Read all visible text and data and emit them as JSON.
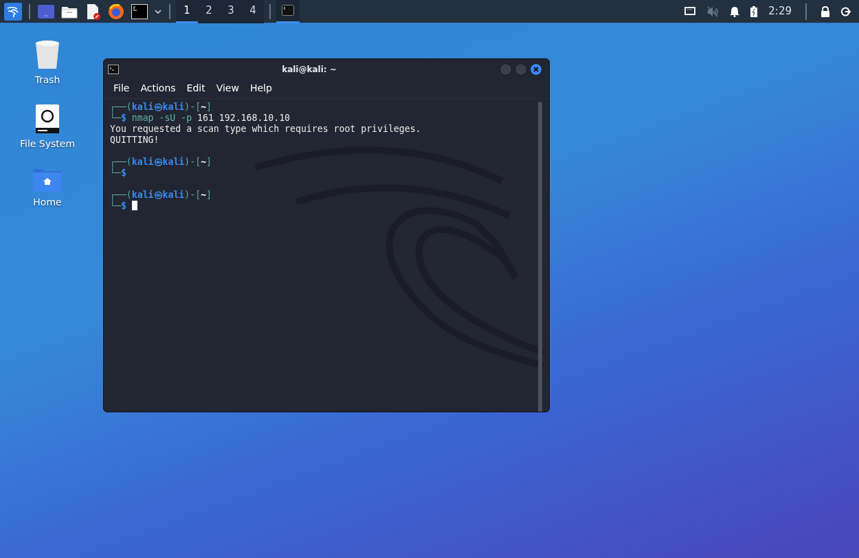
{
  "taskbar": {
    "workspaces": [
      {
        "label": "1",
        "selected": true
      },
      {
        "label": "2",
        "selected": false
      },
      {
        "label": "3",
        "selected": false
      },
      {
        "label": "4",
        "selected": false
      }
    ],
    "tasks": [
      {
        "selected": true
      }
    ],
    "clock": "2:29"
  },
  "desktop_icons": [
    {
      "label": "Trash",
      "kind": "trash"
    },
    {
      "label": "File System",
      "kind": "drive"
    },
    {
      "label": "Home",
      "kind": "home"
    }
  ],
  "window": {
    "title": "kali@kali: ~",
    "menu": [
      "File",
      "Actions",
      "Edit",
      "View",
      "Help"
    ],
    "lines": [
      {
        "segments": [
          {
            "kind": "frame",
            "text": "┌──("
          },
          {
            "kind": "user",
            "text": "kali㉿kali"
          },
          {
            "kind": "frame",
            "text": ")-["
          },
          {
            "kind": "path",
            "text": "~"
          },
          {
            "kind": "frame",
            "text": "]"
          }
        ]
      },
      {
        "segments": [
          {
            "kind": "frame",
            "text": "└─"
          },
          {
            "kind": "user",
            "text": "$"
          },
          {
            "kind": "command",
            "text": " nmap -sU -p"
          },
          {
            "kind": "plain",
            "text": " 161 192.168.10.10"
          }
        ]
      },
      {
        "segments": [
          {
            "kind": "plain",
            "text": "You requested a scan type which requires root privileges."
          }
        ]
      },
      {
        "segments": [
          {
            "kind": "plain",
            "text": "QUITTING!"
          }
        ]
      },
      {
        "kind": "blank"
      },
      {
        "segments": [
          {
            "kind": "frame",
            "text": "┌──("
          },
          {
            "kind": "user",
            "text": "kali㉿kali"
          },
          {
            "kind": "frame",
            "text": ")-["
          },
          {
            "kind": "path",
            "text": "~"
          },
          {
            "kind": "frame",
            "text": "]"
          }
        ]
      },
      {
        "segments": [
          {
            "kind": "frame",
            "text": "└─"
          },
          {
            "kind": "user",
            "text": "$"
          }
        ]
      },
      {
        "kind": "blank"
      },
      {
        "segments": [
          {
            "kind": "frame",
            "text": "┌──("
          },
          {
            "kind": "user",
            "text": "kali㉿kali"
          },
          {
            "kind": "frame",
            "text": ")-["
          },
          {
            "kind": "path",
            "text": "~"
          },
          {
            "kind": "frame",
            "text": "]"
          }
        ]
      },
      {
        "segments": [
          {
            "kind": "frame",
            "text": "└─"
          },
          {
            "kind": "user",
            "text": "$"
          }
        ],
        "cursor": true
      }
    ]
  }
}
